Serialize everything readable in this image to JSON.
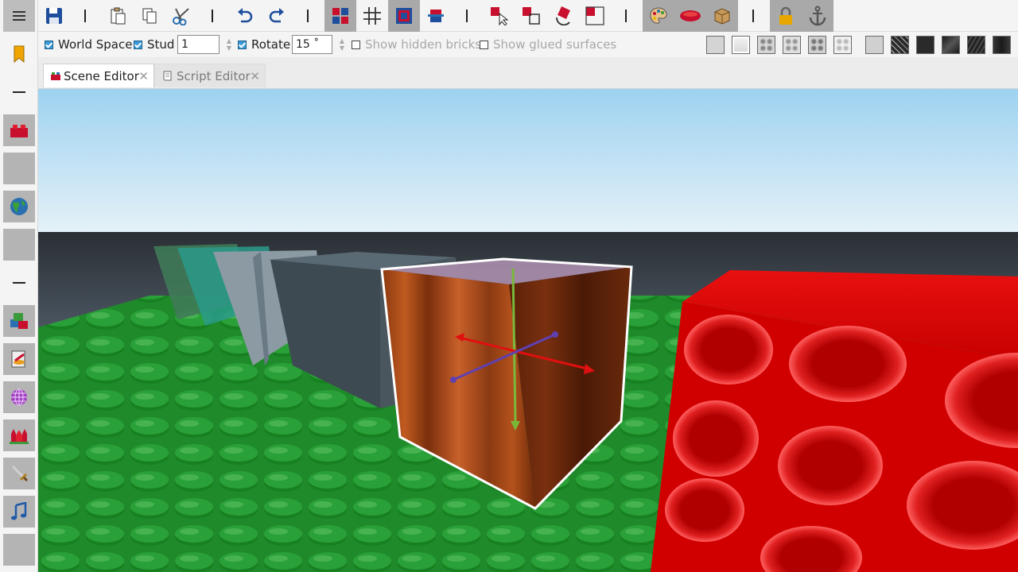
{
  "toolbar": {
    "icons": [
      "save-icon",
      "paste-icon",
      "copy-icon",
      "cut-icon",
      "undo-icon",
      "redo-icon",
      "select-bricks-icon",
      "grid-icon",
      "group-icon",
      "move-icon",
      "select-cursor-icon",
      "resize-icon",
      "rotate-icon",
      "brick-frame-icon",
      "paint-palette-icon",
      "material-icon",
      "texture-box-icon",
      "lock-icon",
      "anchor-icon"
    ]
  },
  "sidebar": {
    "icons": [
      "bookmark-icon",
      "brick-icon",
      "globe-icon",
      "blocks-icon",
      "paint-icon",
      "network-icon",
      "castle-icon",
      "sword-icon",
      "music-icon"
    ]
  },
  "options": {
    "world_space": {
      "label": "World Space",
      "checked": true
    },
    "stud": {
      "label": "Stud",
      "checked": true,
      "value": "1"
    },
    "rotate": {
      "label": "Rotate",
      "checked": true,
      "value": "15 ˚"
    },
    "show_hidden": {
      "label": "Show hidden bricks",
      "checked": false
    },
    "show_glued": {
      "label": "Show glued surfaces",
      "checked": false
    }
  },
  "material_swatches": [
    "plastic",
    "smooth",
    "studs-a",
    "studs-b",
    "studs-c",
    "studs-d",
    "concrete",
    "marble",
    "dark-plain",
    "dark-metal",
    "dark-rough",
    "dark-brushed"
  ],
  "tabs": [
    {
      "label": "Scene Editor",
      "active": true
    },
    {
      "label": "Script Editor",
      "active": false
    }
  ],
  "colors": {
    "accent": "#3a9ad9",
    "brick_red": "#d40000",
    "baseplate_green": "#1f8a2a",
    "sky": "#a9d6f0"
  }
}
